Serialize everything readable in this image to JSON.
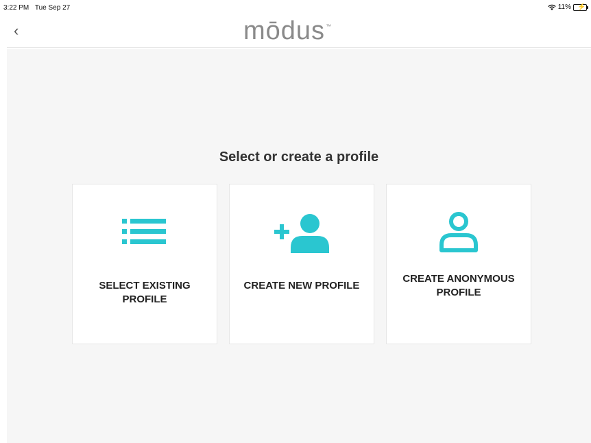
{
  "status_bar": {
    "time": "3:22 PM",
    "date": "Tue Sep 27",
    "battery": "11%",
    "wifi_icon": "wifi-icon"
  },
  "nav": {
    "back_icon": "chevron-left-icon",
    "back_glyph": "‹",
    "logo_text": "mōdus",
    "logo_tm": "™"
  },
  "main": {
    "title": "Select or create a profile",
    "accent_color": "#2ac6d0",
    "options": [
      {
        "label": "SELECT EXISTING PROFILE",
        "icon": "list-icon"
      },
      {
        "label": "CREATE NEW PROFILE",
        "icon": "add-user-icon"
      },
      {
        "label": "CREATE ANONYMOUS PROFILE",
        "icon": "user-outline-icon"
      }
    ]
  }
}
